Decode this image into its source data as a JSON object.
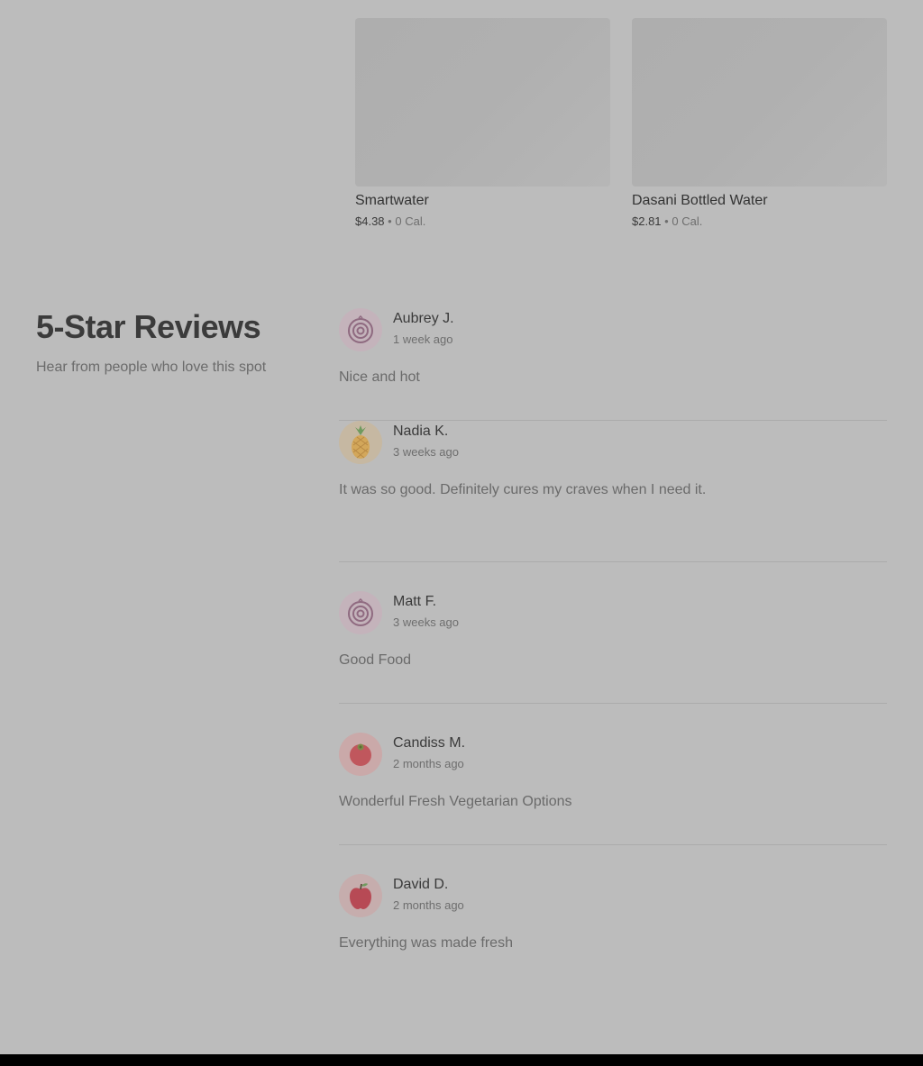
{
  "products": [
    {
      "name": "Smartwater",
      "price": "$4.38",
      "separator": "•",
      "calories": "0 Cal."
    },
    {
      "name": "Dasani Bottled Water",
      "price": "$2.81",
      "separator": "•",
      "calories": "0 Cal."
    }
  ],
  "reviews_section": {
    "title": "5-Star Reviews",
    "subtitle": "Hear from people who love this spot"
  },
  "reviews": [
    {
      "name": "Aubrey J.",
      "date": "1 week ago",
      "text": "Nice and hot",
      "avatar_icon": "onion-icon"
    },
    {
      "name": "Nadia K.",
      "date": "3 weeks ago",
      "text": "It was so good. Definitely cures my craves when I need it.",
      "avatar_icon": "pineapple-icon"
    },
    {
      "name": "Matt F.",
      "date": "3 weeks ago",
      "text": "Good Food",
      "avatar_icon": "onion-icon"
    },
    {
      "name": "Candiss M.",
      "date": "2 months ago",
      "text": "Wonderful Fresh Vegetarian Options",
      "avatar_icon": "tomato-icon"
    },
    {
      "name": "David D.",
      "date": "2 months ago",
      "text": "Everything was made fresh",
      "avatar_icon": "apple-icon"
    }
  ],
  "colors": {
    "overlay_background": "#bcbcbc",
    "onion_avatar_bg": "#c4b3bb",
    "pineapple_avatar_bg": "#c6b8a2",
    "tomato_avatar_bg": "#caa9a9",
    "apple_avatar_bg": "#c6adad",
    "footer": "#000000"
  }
}
